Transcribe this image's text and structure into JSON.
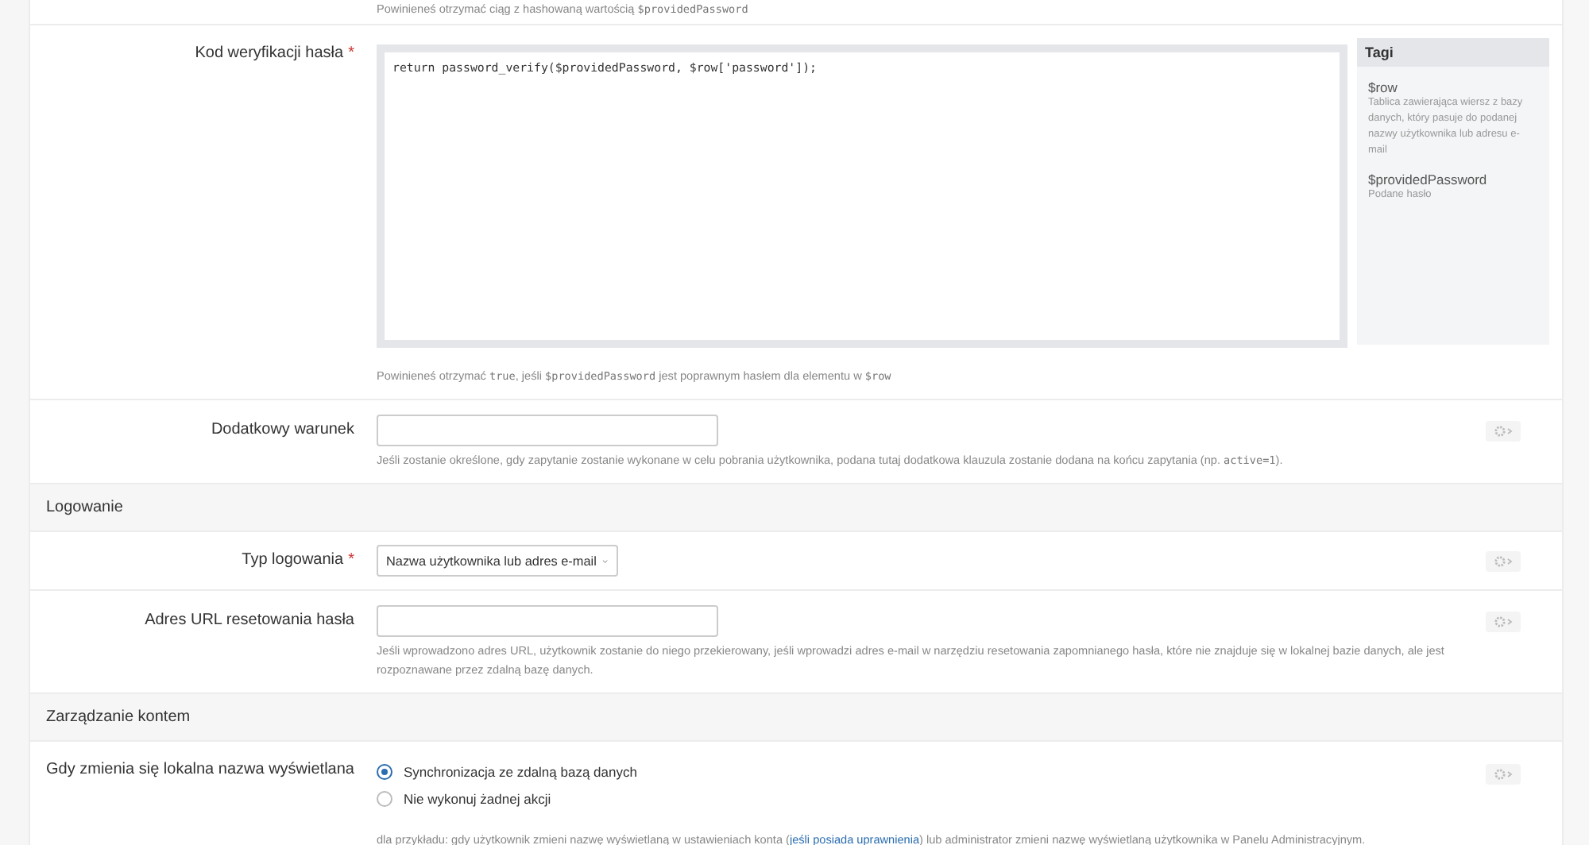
{
  "top_help": [
    {
      "kind": "text",
      "text": "Powinieneś otrzymać ciąg z hashowaną wartością "
    },
    {
      "kind": "code",
      "text": "$providedPassword"
    }
  ],
  "code_field": {
    "label": "Kod weryfikacji hasła",
    "required_mark": "*",
    "value": "return password_verify($providedPassword, $row['password']);",
    "tags_title": "Tagi",
    "tags": [
      {
        "name": "$row",
        "description": "Tablica zawierająca wiersz z bazy danych, który pasuje do podanej nazwy użytkownika lub adresu e-mail"
      },
      {
        "name": "$providedPassword",
        "description": "Podane hasło"
      }
    ],
    "help": [
      {
        "kind": "text",
        "text": "Powinieneś otrzymać "
      },
      {
        "kind": "code",
        "text": "true"
      },
      {
        "kind": "text",
        "text": ", jeśli "
      },
      {
        "kind": "code",
        "text": "$providedPassword"
      },
      {
        "kind": "text",
        "text": " jest poprawnym hasłem dla elementu w "
      },
      {
        "kind": "code",
        "text": "$row"
      }
    ]
  },
  "extra_condition": {
    "label": "Dodatkowy warunek",
    "help": [
      {
        "kind": "text",
        "text": "Jeśli zostanie określone, gdy zapytanie zostanie wykonane w celu pobrania użytkownika, podana tutaj dodatkowa klauzula zostanie dodana na końcu zapytania (np. "
      },
      {
        "kind": "code",
        "text": "active=1"
      },
      {
        "kind": "text",
        "text": ")."
      }
    ]
  },
  "sections": [
    {
      "title": "Logowanie",
      "fields": [
        {
          "kind": "select",
          "label": "Typ logowania",
          "required_mark": "*",
          "value": "Nazwa użytkownika lub adres e-mail"
        },
        {
          "kind": "input",
          "label": "Adres URL resetowania hasła",
          "help": [
            {
              "kind": "text",
              "text": "Jeśli wprowadzono adres URL, użytkownik zostanie do niego przekierowany, jeśli wprowadzi adres e-mail w narzędziu resetowania zapomnianego hasła, które nie znajduje się w lokalnej bazie danych, ale jest rozpoznawane przez zdalną bazę danych."
            }
          ]
        }
      ]
    },
    {
      "title": "Zarządzanie kontem",
      "fields": [
        {
          "kind": "radio",
          "label": "Gdy zmienia się lokalna nazwa wyświetlana",
          "options": [
            {
              "label": "Synchronizacja ze zdalną bazą danych",
              "selected": true
            },
            {
              "label": "Nie wykonuj żadnej akcji",
              "selected": false
            }
          ],
          "help": [
            {
              "kind": "text",
              "text": "dla przykładu: gdy użytkownik zmieni nazwę wyświetlaną w ustawieniach konta ("
            },
            {
              "kind": "link",
              "text": "jeśli posiada uprawnienia"
            },
            {
              "kind": "text",
              "text": ") lub administrator zmieni nazwę wyświetlaną użytkownika w Panelu Administracyjnym."
            }
          ]
        }
      ]
    }
  ]
}
